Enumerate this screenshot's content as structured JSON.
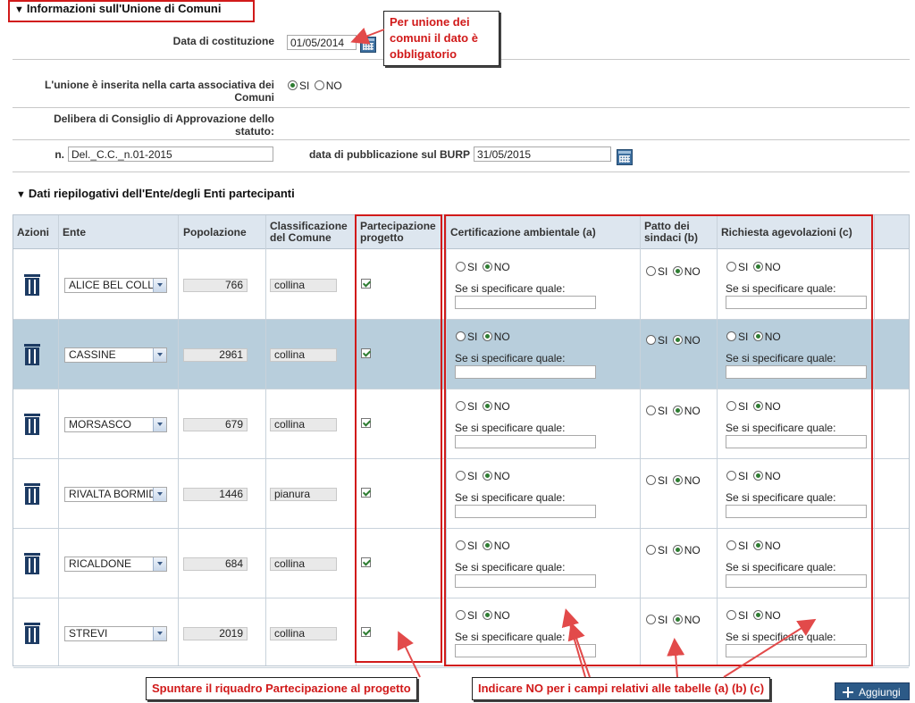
{
  "section1": {
    "title": "Informazioni sull'Unione di Comuni",
    "data_costituzione_label": "Data di costituzione",
    "data_costituzione_value": "01/05/2014",
    "unione_label": "L'unione è inserita nella carta associativa dei Comuni",
    "unione_si": "SI",
    "unione_no": "NO",
    "unione_selected": "SI",
    "delibera_label": "Delibera di Consiglio di Approvazione dello statuto:",
    "n_label": "n.",
    "n_value": "Del._C.C._n.01-2015",
    "burp_label": "data di pubblicazione sul BURP",
    "burp_value": "31/05/2015"
  },
  "section2": {
    "title": "Dati riepilogativi dell'Ente/degli Enti partecipanti"
  },
  "table": {
    "headers": {
      "azioni": "Azioni",
      "ente": "Ente",
      "popolazione": "Popolazione",
      "classificazione": "Classificazione del Comune",
      "partecipazione": "Partecipazione progetto",
      "certificazione": "Certificazione ambientale (a)",
      "patto": "Patto dei sindaci (b)",
      "richiesta": "Richiesta agevolazioni (c)"
    },
    "si_label": "SI",
    "no_label": "NO",
    "spec_label": "Se si specificare quale:",
    "rows": [
      {
        "ente": "ALICE BEL COLLI",
        "popolazione": "766",
        "classificazione": "collina",
        "partecipazione": true,
        "cert": "NO",
        "patto": "NO",
        "richiesta": "NO"
      },
      {
        "ente": "CASSINE",
        "popolazione": "2961",
        "classificazione": "collina",
        "partecipazione": true,
        "cert": "NO",
        "patto": "NO",
        "richiesta": "NO"
      },
      {
        "ente": "MORSASCO",
        "popolazione": "679",
        "classificazione": "collina",
        "partecipazione": true,
        "cert": "NO",
        "patto": "NO",
        "richiesta": "NO"
      },
      {
        "ente": "RIVALTA BORMIDA",
        "popolazione": "1446",
        "classificazione": "pianura",
        "partecipazione": true,
        "cert": "NO",
        "patto": "NO",
        "richiesta": "NO"
      },
      {
        "ente": "RICALDONE",
        "popolazione": "684",
        "classificazione": "collina",
        "partecipazione": true,
        "cert": "NO",
        "patto": "NO",
        "richiesta": "NO"
      },
      {
        "ente": "STREVI",
        "popolazione": "2019",
        "classificazione": "collina",
        "partecipazione": true,
        "cert": "NO",
        "patto": "NO",
        "richiesta": "NO"
      }
    ]
  },
  "annotations": {
    "callout_top": [
      "Per unione dei",
      "comuni il dato è",
      "obbligatorio"
    ],
    "callout_partecipazione": "Spuntare il riquadro Partecipazione al progetto",
    "callout_no": "Indicare NO per i campi relativi alle tabelle (a) (b) (c)"
  },
  "button_add": "Aggiungi",
  "colors": {
    "annotation_red": "#d11a1a",
    "header_bg": "#dde6ef",
    "selected_row": "#b8cedc",
    "button": "#2c5a87"
  }
}
